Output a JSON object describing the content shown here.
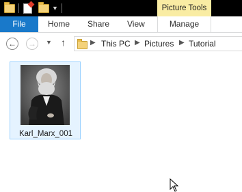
{
  "context_tab": {
    "label": "Picture Tools"
  },
  "ribbon": {
    "file_label": "File",
    "tabs": [
      "Home",
      "Share",
      "View"
    ],
    "manage_label": "Manage"
  },
  "address": {
    "breadcrumbs": [
      "This PC",
      "Pictures",
      "Tutorial"
    ]
  },
  "files": [
    {
      "name": "Karl_Marx_001",
      "selected": true,
      "type": "image"
    }
  ],
  "colors": {
    "file_tab": "#1979ca",
    "context_tab": "#f9eca3",
    "selection_fill": "#e5f3ff",
    "selection_border": "#99d1ff"
  }
}
